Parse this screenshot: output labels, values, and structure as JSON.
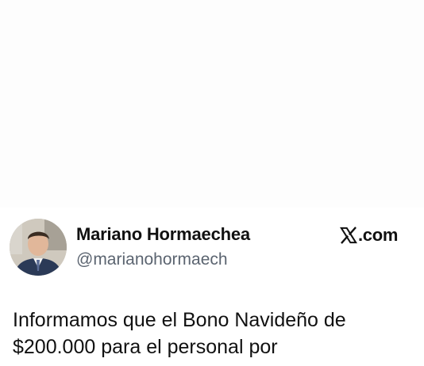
{
  "post": {
    "author": {
      "display_name": "Mariano Hormaechea",
      "handle": "@marianohormaech",
      "avatar_icon": "person-avatar-icon"
    },
    "brand": {
      "icon": "x-logo-icon",
      "text": ".com"
    },
    "text_lines": [
      "Informamos que el Bono Navideño de",
      "$200.000 para el personal por"
    ]
  },
  "colors": {
    "text": "#111111",
    "secondary": "#5b6470",
    "background": "#ffffff"
  }
}
